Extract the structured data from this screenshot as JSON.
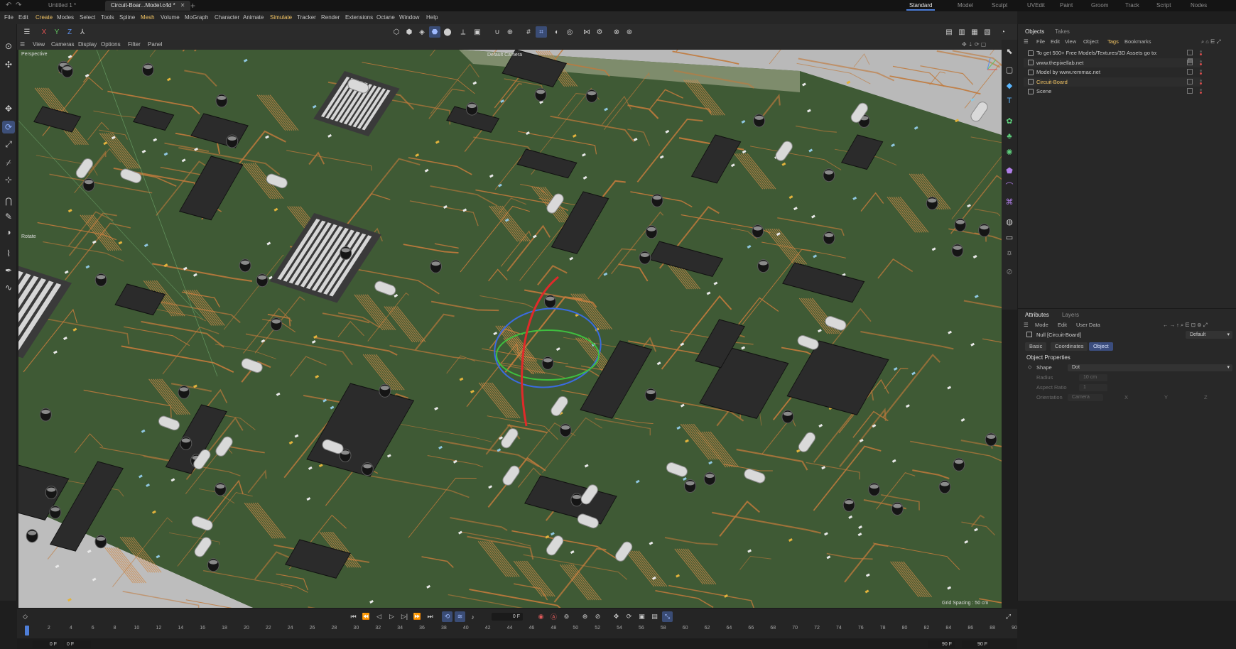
{
  "titlebar": {
    "doc_tabs": [
      {
        "label": "Untitled 1 *",
        "active": false
      },
      {
        "label": "Circuit-Boar...Model.c4d *",
        "active": true
      }
    ],
    "new_tab": "+",
    "workspaces": [
      "Standard",
      "Model",
      "Sculpt",
      "UVEdit",
      "Paint",
      "Groom",
      "Track",
      "Script",
      "Nodes"
    ],
    "active_workspace": "Standard"
  },
  "menubar": {
    "items": [
      "File",
      "Edit",
      "Create",
      "Modes",
      "Select",
      "Tools",
      "Spline",
      "Mesh",
      "Volume",
      "MoGraph",
      "Character",
      "Animate",
      "Simulate",
      "Tracker",
      "Render",
      "Extensions",
      "Octane",
      "Window",
      "Help"
    ],
    "highlighted": [
      "Create",
      "Mesh",
      "Simulate"
    ]
  },
  "toolbar": {
    "axes": [
      "X",
      "Y",
      "Z"
    ]
  },
  "viewport": {
    "menu": [
      "View",
      "Cameras",
      "Display",
      "Options",
      "Filter",
      "Panel"
    ],
    "projection": "Perspective",
    "camera": "Default Camera",
    "grid_spacing": "Grid Spacing : 50 cm",
    "rotate_label": "Rotate"
  },
  "object_manager": {
    "tabs": [
      "Objects",
      "Takes"
    ],
    "menu": [
      "File",
      "Edit",
      "View",
      "Object",
      "Tags",
      "Bookmarks"
    ],
    "highlighted_menu": "Tags",
    "objects": [
      {
        "name": "To get 500+ Free Models/Textures/3D Assets go to:",
        "highlight": false
      },
      {
        "name": "www.thepixellab.net",
        "highlight": false
      },
      {
        "name": "Model by www.remmac.net",
        "highlight": false
      },
      {
        "name": "Circuit-Board",
        "highlight": true
      },
      {
        "name": "Scene",
        "highlight": false
      }
    ]
  },
  "attributes": {
    "tabs": [
      "Attributes",
      "Layers"
    ],
    "menu": [
      "Mode",
      "Edit",
      "User Data"
    ],
    "object_title": "Null [Circuit-Board]",
    "preset": "Default",
    "sub_tabs": [
      "Basic",
      "Coordinates",
      "Object"
    ],
    "active_sub_tab": "Object",
    "section_title": "Object Properties",
    "properties": [
      {
        "label": "Shape",
        "value": "Dot",
        "enabled": true
      },
      {
        "label": "Radius",
        "value": "10 cm",
        "enabled": false
      },
      {
        "label": "Aspect Ratio",
        "value": "1",
        "enabled": false
      },
      {
        "label": "Orientation",
        "value": "Camera",
        "enabled": false
      }
    ],
    "orientation_axes": [
      "X",
      "Y",
      "Z"
    ]
  },
  "timeline": {
    "current_frame": "0 F",
    "start_frame": "0 F",
    "min_frame": "0 F",
    "end_frame": "90 F",
    "max_frame": "90 F",
    "ticks": [
      "0",
      "2",
      "4",
      "6",
      "8",
      "10",
      "12",
      "14",
      "16",
      "18",
      "20",
      "22",
      "24",
      "26",
      "28",
      "30",
      "32",
      "34",
      "36",
      "38",
      "40",
      "42",
      "44",
      "46",
      "48",
      "50",
      "52",
      "54",
      "56",
      "58",
      "60",
      "62",
      "64",
      "66",
      "68",
      "70",
      "72",
      "74",
      "76",
      "78",
      "80",
      "82",
      "84",
      "86",
      "88",
      "90"
    ],
    "playhead_fraction": 0
  },
  "colors": {
    "accent": "#4e7ed8",
    "highlight_text": "#f2c464",
    "pcb_green": "#3f5a35",
    "copper": "#c07a3c",
    "chip": "#2b2b2b"
  }
}
